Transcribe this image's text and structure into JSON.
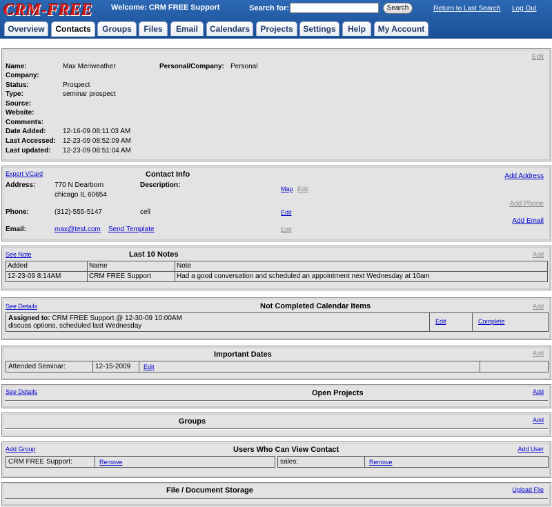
{
  "header": {
    "logo": "CRM-FREE",
    "welcome": "Welcome: CRM FREE Support",
    "search_label": "Search for:",
    "search_value": "",
    "search_button": "Search",
    "return_link": "Return to Last Search",
    "logout_link": "Log Out"
  },
  "tabs": [
    "Overview",
    "Contacts",
    "Groups",
    "Files",
    "Email",
    "Calendars",
    "Projects",
    "Settings",
    "Help",
    "My Account"
  ],
  "active_tab": "Contacts",
  "contact": {
    "edit": "Edit",
    "name_label": "Name:",
    "name": "Max Meriweather",
    "pc_label": "Personal/Company:",
    "pc_value": "Personal",
    "company_label": "Company:",
    "company": "",
    "status_label": "Status:",
    "status": "Prospect",
    "type_label": "Type:",
    "type": "seminar prospect",
    "source_label": "Source:",
    "source": "",
    "website_label": "Website:",
    "website": "",
    "comments_label": "Comments:",
    "comments": "",
    "date_added_label": "Date Added:",
    "date_added": "12-16-09 08:11:03 AM",
    "last_accessed_label": "Last Accessed:",
    "last_accessed": "12-23-09 08:52:09 AM",
    "last_updated_label": "Last updated:",
    "last_updated": "12-23-09 08:51:04 AM"
  },
  "contact_info": {
    "title": "Contact Info",
    "export_vcard": "Export VCard",
    "add_address": "Add Address",
    "add_phone": "Add Phone",
    "add_email": "Add Email",
    "address_label": "Address:",
    "address_line1": "770 N Dearborn",
    "address_line2": "chicago IL 60654",
    "description_label": "Description:",
    "map": "Map",
    "address_edit": "Edit",
    "phone_label": "Phone:",
    "phone": "(312)-555-5147",
    "phone_desc": "cell",
    "phone_edit": "Edit",
    "email_label": "Email:",
    "email": "max@test.com",
    "send_template": "Send Template",
    "email_edit": "Edit"
  },
  "notes": {
    "title": "Last 10 Notes",
    "see_note": "See Note",
    "add": "Add",
    "headers": [
      "Added",
      "Name",
      "Note"
    ],
    "rows": [
      [
        "12-23-09 8:14AM",
        "CRM FREE Support",
        "Had a good conversation and scheduled an appointment next Wednesday at 10am"
      ]
    ]
  },
  "calendar": {
    "title": "Not Completed Calendar Items",
    "see_details": "See Details",
    "add": "Add",
    "assigned_label": "Assigned to:",
    "assigned_value": "CRM FREE Support @ 12-30-09 10:00AM",
    "description": "discuss options, scheduled last Wednesday",
    "edit": "Edit",
    "complete": "Complete"
  },
  "important_dates": {
    "title": "Important Dates",
    "add": "Add",
    "label": "Attended Seminar:",
    "date": "12-15-2009",
    "edit": "Edit"
  },
  "projects": {
    "title": "Open Projects",
    "see_details": "See Details",
    "add": "Add"
  },
  "groups": {
    "title": "Groups",
    "add": "Add"
  },
  "users": {
    "title": "Users Who Can View Contact",
    "add_group": "Add Group",
    "add_user": "Add User",
    "user1": "CRM FREE Support:",
    "user1_remove": "Remove",
    "user2": "sales:",
    "user2_remove": "Remove"
  },
  "files": {
    "title": "File / Document Storage",
    "upload": "Upload File"
  }
}
